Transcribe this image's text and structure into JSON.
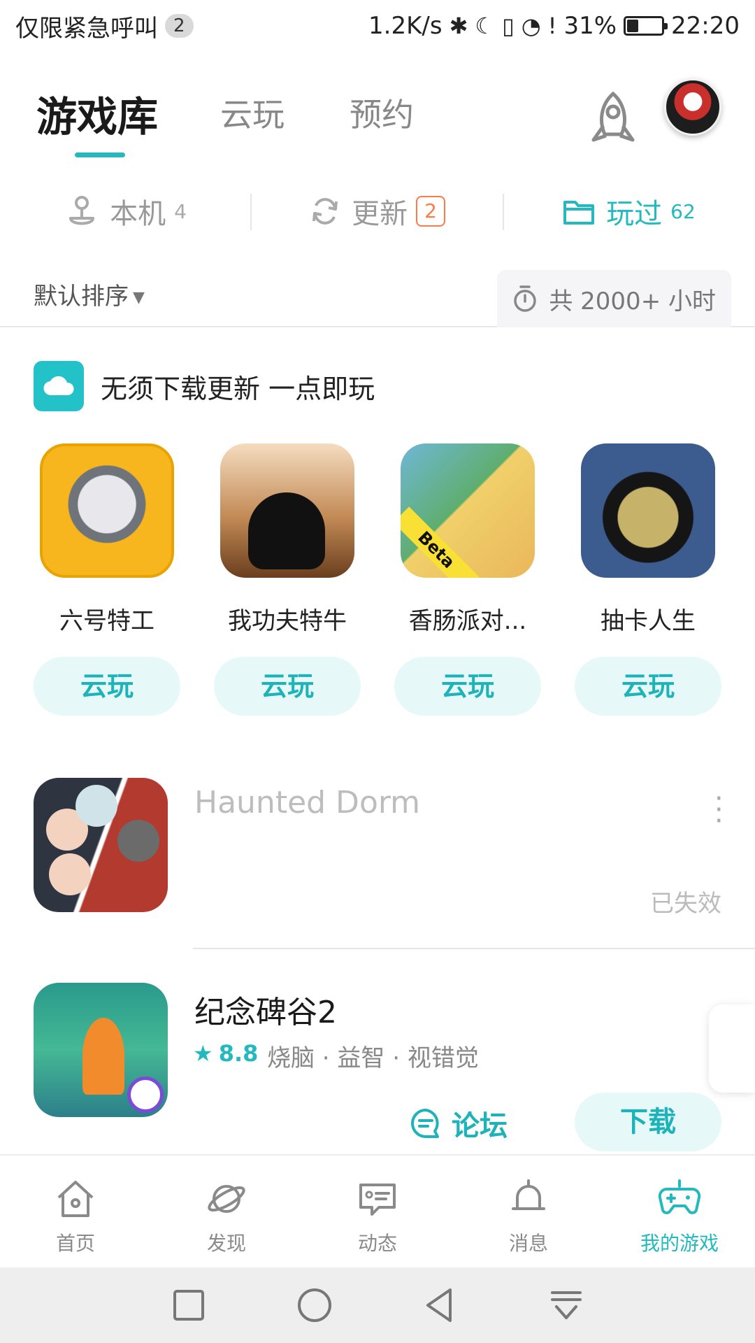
{
  "status_bar": {
    "emergency": "仅限紧急呼叫",
    "sim_badge": "2",
    "speed": "1.2K/s",
    "battery": "31%",
    "battery_level": 0.31,
    "time": "22:20"
  },
  "top_tabs": [
    {
      "label": "游戏库",
      "active": true
    },
    {
      "label": "云玩",
      "active": false
    },
    {
      "label": "预约",
      "active": false
    }
  ],
  "filters": {
    "local": {
      "label": "本机",
      "count": "4"
    },
    "update": {
      "label": "更新",
      "count": "2"
    },
    "played": {
      "label": "玩过",
      "count": "62"
    }
  },
  "sort": {
    "label": "默认排序"
  },
  "hours": {
    "label": "共 2000+ 小时"
  },
  "cloud_section": {
    "title": "无须下载更新 一点即玩",
    "games": [
      {
        "name": "六号特工",
        "button": "云玩"
      },
      {
        "name": "我功夫特牛",
        "button": "云玩"
      },
      {
        "name": "香肠派对...",
        "button": "云玩",
        "badge": "Beta"
      },
      {
        "name": "抽卡人生",
        "button": "云玩"
      }
    ]
  },
  "list": [
    {
      "title": "Haunted Dorm",
      "status": "已失效"
    },
    {
      "title": "纪念碑谷2",
      "rating": "8.8",
      "tags": "烧脑 · 益智 · 视错觉",
      "forum": "论坛",
      "download": "下载"
    }
  ],
  "bottom_nav": [
    {
      "label": "首页",
      "icon": "home-icon"
    },
    {
      "label": "发现",
      "icon": "planet-icon"
    },
    {
      "label": "动态",
      "icon": "feed-icon"
    },
    {
      "label": "消息",
      "icon": "bell-icon"
    },
    {
      "label": "我的游戏",
      "icon": "gamepad-icon",
      "active": true
    }
  ],
  "colors": {
    "accent": "#23b9bf",
    "badge": "#ff7a45"
  }
}
